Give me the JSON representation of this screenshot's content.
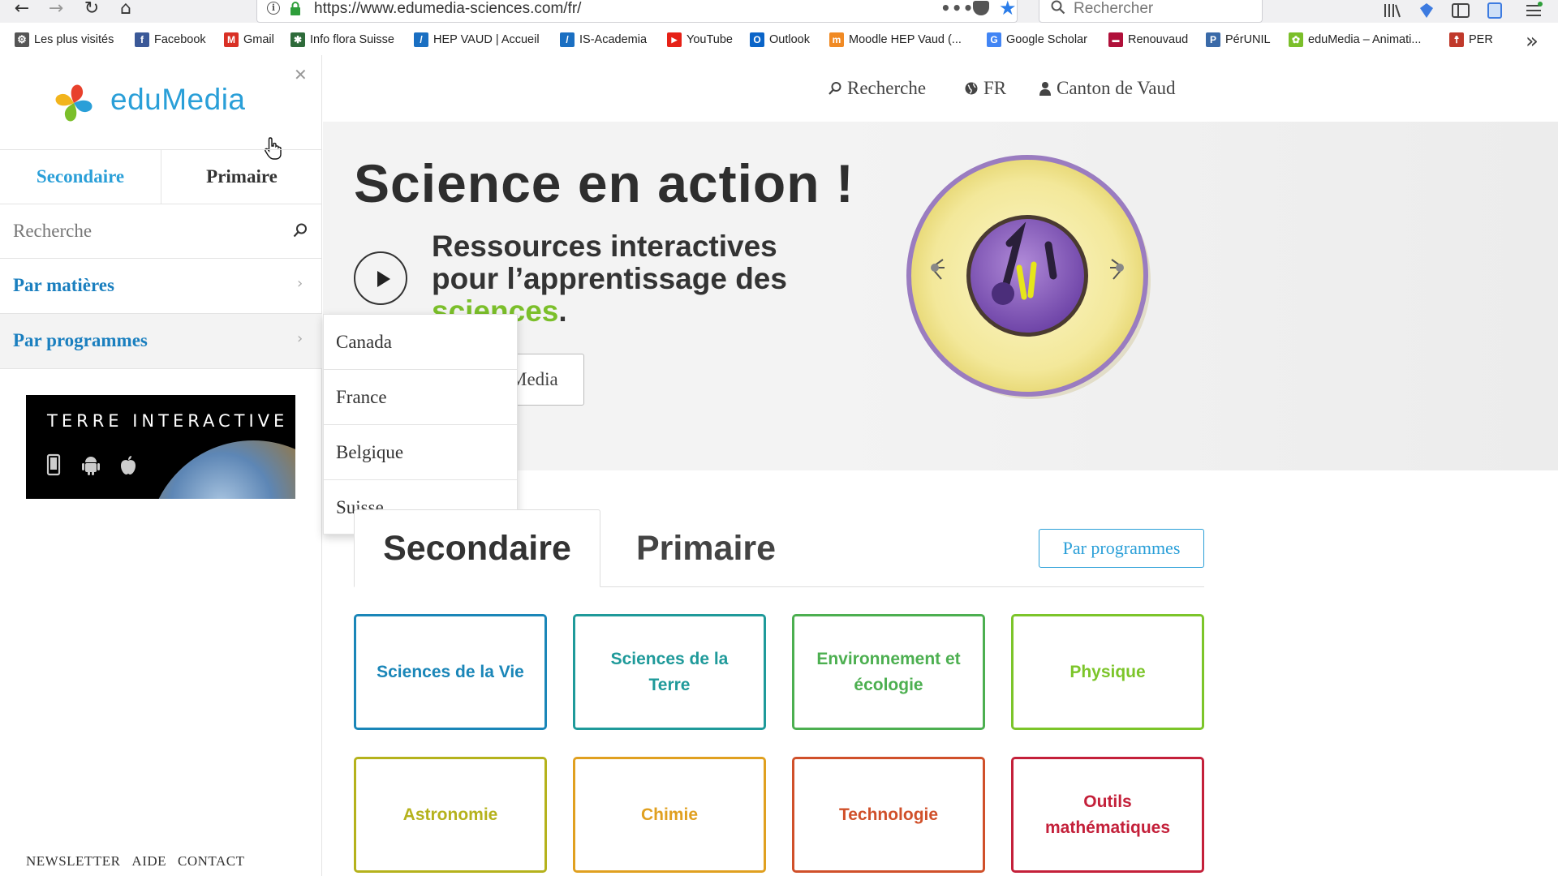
{
  "browser": {
    "url": "https://www.edumedia-sciences.com/fr/",
    "search_placeholder": "Rechercher",
    "bookmarks": [
      {
        "label": "Les plus visités",
        "color": "#555555",
        "glyph": "⚙"
      },
      {
        "label": "Facebook",
        "color": "#3b5998",
        "glyph": "f"
      },
      {
        "label": "Gmail",
        "color": "#d93025",
        "glyph": "M"
      },
      {
        "label": "Info flora Suisse",
        "color": "#2e6b3a",
        "glyph": "✱"
      },
      {
        "label": "HEP VAUD | Accueil",
        "color": "#1a6fc2",
        "glyph": "/"
      },
      {
        "label": "IS-Academia",
        "color": "#1a6fc2",
        "glyph": "/"
      },
      {
        "label": "YouTube",
        "color": "#e62117",
        "glyph": "▶"
      },
      {
        "label": "Outlook",
        "color": "#0a64c8",
        "glyph": "O"
      },
      {
        "label": "Moodle HEP Vaud (...",
        "color": "#f08a24",
        "glyph": "m"
      },
      {
        "label": "Google Scholar",
        "color": "#4285f4",
        "glyph": "G"
      },
      {
        "label": "Renouvaud",
        "color": "#b0103a",
        "glyph": "▬"
      },
      {
        "label": "PérUNIL",
        "color": "#3a6aa8",
        "glyph": "P"
      },
      {
        "label": "eduMedia – Animati...",
        "color": "#7bbf2a",
        "glyph": "✿"
      },
      {
        "label": "PER",
        "color": "#c0392b",
        "glyph": "☨"
      }
    ]
  },
  "sidebar": {
    "logo_text": "eduMedia",
    "tabs": {
      "secondary": "Secondaire",
      "primary": "Primaire"
    },
    "search_placeholder": "Recherche",
    "items": [
      {
        "label": "Par matières"
      },
      {
        "label": "Par programmes"
      }
    ],
    "promo": {
      "title": "TERRE INTERACTIVE"
    },
    "footer": {
      "newsletter": "NEWSLETTER",
      "help": "AIDE",
      "contact": "CONTACT"
    }
  },
  "topnav": {
    "search": "Recherche",
    "lang": "FR",
    "account": "Canton de Vaud"
  },
  "hero": {
    "title": "Science en action !",
    "subtitle_line1": "Ressources interactives",
    "subtitle_line2": "pour l’apprentissage des",
    "subtitle_green": "sciences",
    "subtitle_end": ".",
    "button_partial": "Media"
  },
  "dropdown": {
    "items": [
      "Canada",
      "France",
      "Belgique",
      "Suisse"
    ]
  },
  "level_tabs": {
    "secondary": "Secondaire",
    "primary": "Primaire"
  },
  "par_programmes_button": "Par programmes",
  "subjects": [
    {
      "label": "Sciences de la Vie",
      "color": "#1a86b8"
    },
    {
      "label": "Sciences de la Terre",
      "color": "#1f9a9a"
    },
    {
      "label": "Environnement et écologie",
      "color": "#4caf50"
    },
    {
      "label": "Physique",
      "color": "#7cc52a"
    },
    {
      "label": "Astronomie",
      "color": "#b5b21c"
    },
    {
      "label": "Chimie",
      "color": "#e0a020"
    },
    {
      "label": "Technologie",
      "color": "#d0502a"
    },
    {
      "label": "Outils mathématiques",
      "color": "#c4203a"
    }
  ]
}
